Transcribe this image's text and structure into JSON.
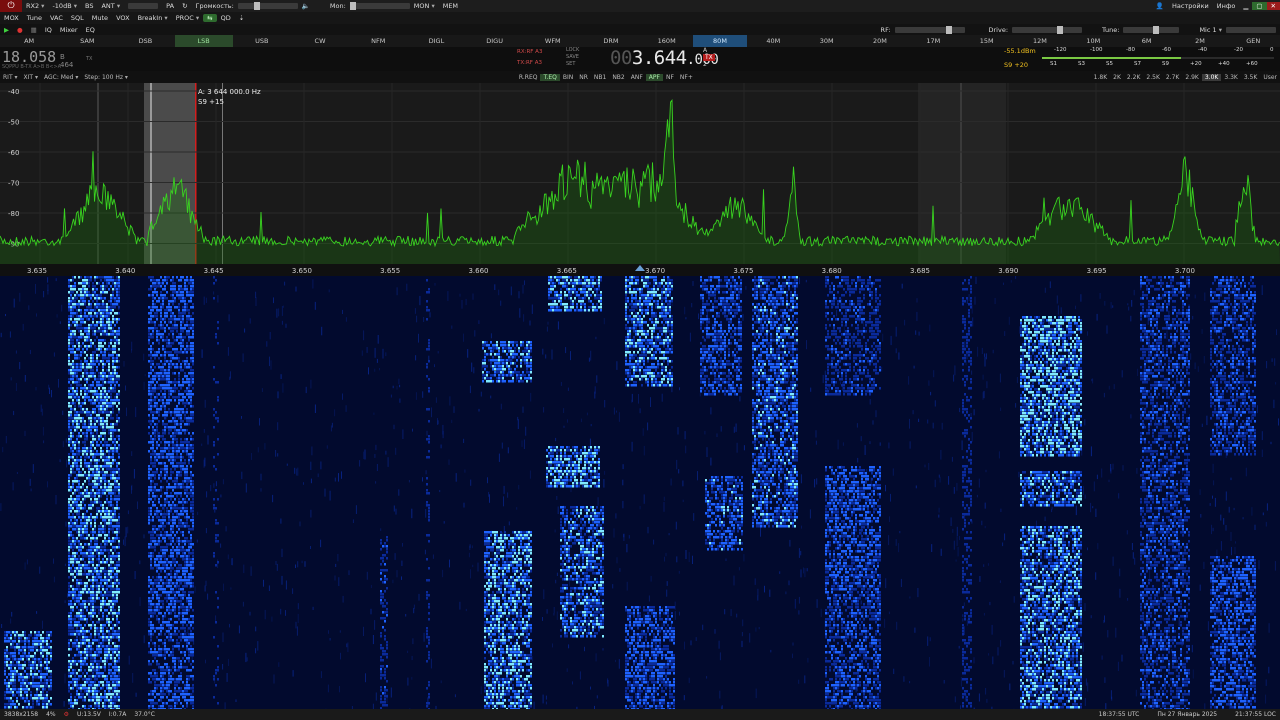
{
  "toolbar1": {
    "power_icon": "power-icon",
    "rx2": "RX2",
    "att": "-10dB",
    "bs": "BS",
    "ant": "ANT",
    "pa": "PA",
    "loop_icon": "loop-icon",
    "volume_label": "Громкость:",
    "speaker_icon": "speaker-icon",
    "mon_label": "Mon:",
    "mon": "MON",
    "mem": "MEM",
    "account_icon": "account-icon",
    "settings": "Настройки",
    "info": "Инфо",
    "minimize_icon": "minimize-icon",
    "maximize_icon": "maximize-icon",
    "close_icon": "close-icon",
    "volume_level": 0.3,
    "mon_level": 0.0
  },
  "toolbar2": {
    "items": [
      "MOX",
      "Tune",
      "VAC",
      "SQL",
      "Mute",
      "VOX",
      "BreakIn",
      "PROC"
    ],
    "toggle_icon": "toggle-icon",
    "qd": "QD",
    "ptt_icon": "ptt-icon"
  },
  "toolbar3": {
    "play_icon": "play-icon",
    "record_icon": "record-icon",
    "iq": "IQ",
    "mixer": "Mixer",
    "eq": "EQ",
    "rf_label": "RF:",
    "drive_label": "Drive:",
    "tune_label": "Tune:",
    "mic_label": "Mic 1",
    "rf_level": 0.8,
    "drive_level": 0.7,
    "tune_level": 0.6
  },
  "modes": {
    "items": [
      "AM",
      "SAM",
      "DSB",
      "LSB",
      "USB",
      "CW",
      "NFM",
      "DIGL",
      "DIGU",
      "WFM",
      "DRM"
    ],
    "active": "LSB"
  },
  "bands": {
    "items": [
      "160M",
      "80M",
      "40M",
      "30M",
      "20M",
      "17M",
      "15M",
      "12M",
      "10M",
      "6M",
      "2M",
      "GEN"
    ],
    "active": "80M"
  },
  "vfo": {
    "b_main": "18.058",
    "b_sub": "464",
    "b_tag": "B",
    "b_tx": "TX",
    "b_labels": "SQPPU B-TX  A>B  B<>A",
    "rx_ant": "RX:RF A3",
    "tx_ant": "TX:RF A3",
    "lock": "LOCK",
    "save": "SAVE",
    "set": "SET",
    "a_prefix": "00",
    "a_main": "3.644",
    "a_sub": ".000",
    "a_tag": "A",
    "a_tx": "TX",
    "a_num": "2"
  },
  "meter": {
    "dbm": "-55.1dBm",
    "s": "S9 +20",
    "top_ticks": [
      "-120",
      "-100",
      "-80",
      "-60",
      "-40",
      "-20",
      "0"
    ],
    "bottom_ticks": [
      "S1",
      "S3",
      "S5",
      "S7",
      "S9",
      "+20",
      "+40",
      "+60"
    ],
    "level": 0.6
  },
  "functions": {
    "rit": "RIT",
    "xit": "XIT",
    "agc": "AGC: Med",
    "step": "Step: 100 Hz",
    "items": [
      "R.REQ",
      "T.EQ",
      "BIN",
      "NR",
      "NB1",
      "NB2",
      "ANF",
      "APF",
      "NF",
      "NF+"
    ],
    "on": [
      "T.EQ",
      "APF"
    ],
    "bandwidths": [
      "1.8K",
      "2K",
      "2.2K",
      "2.5K",
      "2.7K",
      "2.9K",
      "3.0K",
      "3.3K",
      "3.5K",
      "User"
    ],
    "bw_active": "3.0K"
  },
  "pan": {
    "db_labels": [
      "-40",
      "-50",
      "-60",
      "-70",
      "-80",
      "-90"
    ],
    "cursor_freq": "A: 3 644 000.0 Hz",
    "cursor_s": "S9 +15",
    "freq_labels": [
      "3.635",
      "3.640",
      "3.645",
      "3.650",
      "3.655",
      "3.660",
      "3.665",
      "3.670",
      "3.675",
      "3.680",
      "3.685",
      "3.690",
      "3.695",
      "3.700"
    ],
    "colors": {
      "spectrum": "#39d320",
      "background": "#1a1a1a",
      "filter": "#5c5c5c",
      "cursor": "#d21f1f"
    }
  },
  "waterfall": {
    "colors": {
      "background": "#020a2e",
      "low": "#0a2a9a",
      "mid": "#1e62ff",
      "high": "#7fe9ff"
    }
  },
  "status": {
    "resolution": "3838x2158",
    "cpu": "4%",
    "voltage": "U:13.5V",
    "current": "I:0.7A",
    "temp": "37.0°C",
    "utc": "18:37:55 UTC",
    "date": "Пн 27 Январь 2025",
    "local": "21:37:55 LOC"
  }
}
